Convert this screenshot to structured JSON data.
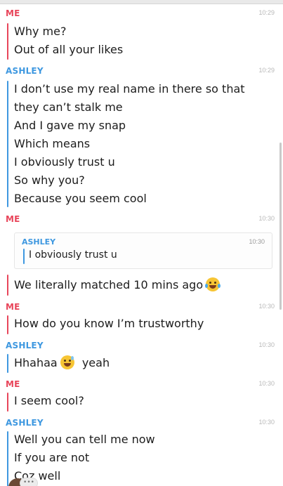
{
  "conversation": [
    {
      "sender": "ME",
      "time": "10:29",
      "lines": [
        "Why me?",
        "Out of all your likes"
      ]
    },
    {
      "sender": "ASHLEY",
      "time": "10:29",
      "lines": [
        "I don’t use my real name in there so that",
        "they can’t stalk me",
        "And I gave my snap",
        "Which means",
        "I obviously trust u",
        "So why you?",
        "Because you seem cool"
      ]
    },
    {
      "sender": "ME",
      "time": "10:30",
      "quote": {
        "sender": "ASHLEY",
        "time": "10:30",
        "text": "I obviously trust u"
      },
      "lines": [
        "We literally matched 10 mins ago"
      ]
    },
    {
      "sender": "ME",
      "time": "10:30",
      "lines": [
        "How do you know I’m trustworthy"
      ]
    },
    {
      "sender": "ASHLEY",
      "time": "10:30",
      "lines": [
        "Hhahaa",
        "yeah"
      ]
    },
    {
      "sender": "ME",
      "time": "10:30",
      "lines": [
        "I seem cool?"
      ]
    },
    {
      "sender": "ASHLEY",
      "time": "10:30",
      "lines": [
        "Well you can tell me now",
        "If you are not",
        "Coz well"
      ]
    }
  ],
  "typing_indicator": "•••",
  "colors": {
    "me": "#e8455a",
    "ashley": "#3e98e0"
  },
  "icons": {
    "laugh_emoji": "face-with-tears-of-joy",
    "sweat_emoji": "grinning-face-with-sweat"
  }
}
